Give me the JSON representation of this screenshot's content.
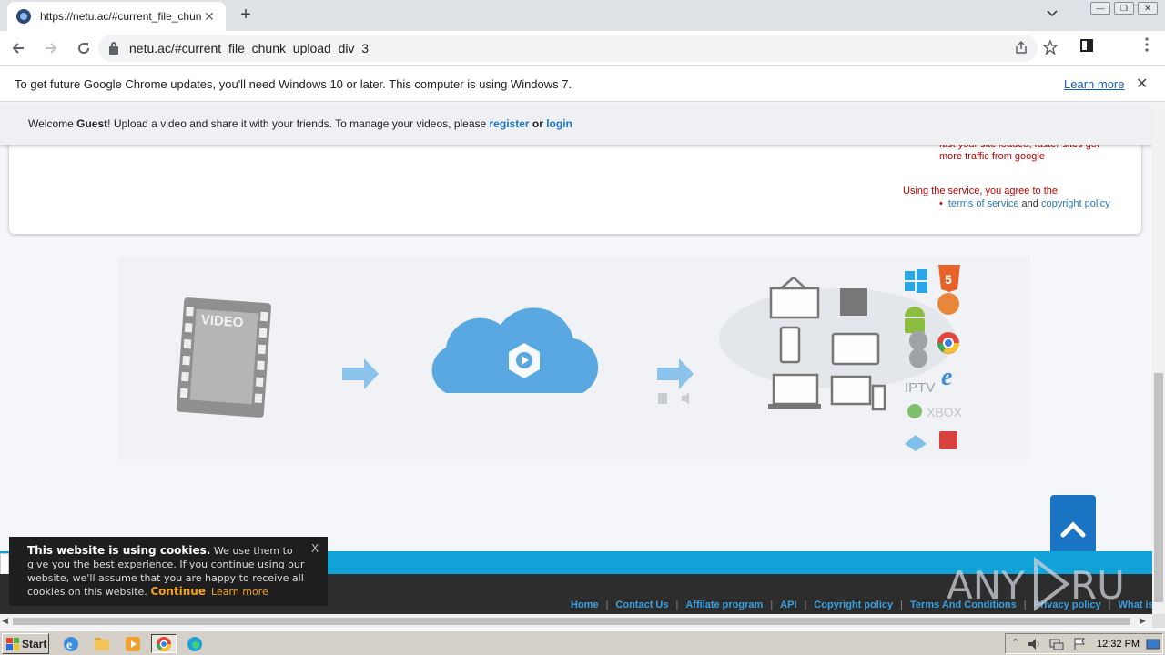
{
  "browser": {
    "tab_title": "https://netu.ac/#current_file_chunk",
    "tab_close": "✕",
    "new_tab": "+",
    "url": "netu.ac/#current_file_chunk_upload_div_3"
  },
  "infobar": {
    "message": "To get future Google Chrome updates, you'll need Windows 10 or later. This computer is using Windows 7.",
    "learn_more": "Learn more",
    "close": "✕"
  },
  "welcome": {
    "prefix": "Welcome ",
    "user": "Guest",
    "middle": "! Upload a video and share it with your friends. To manage your videos, please ",
    "register": "register",
    "or": " or ",
    "login": "login"
  },
  "panel": {
    "speed_line1": "fast your site loaded, faster sites got",
    "speed_line2": "more traffic from google",
    "agree": "Using the service, you agree to the",
    "terms": "terms of service",
    "and": " and ",
    "copyright": "copyright policy"
  },
  "illustration": {
    "film_label": "VIDEO",
    "iptv_label": "IPTV",
    "xbox_label": "XBOX",
    "html5_label": "5"
  },
  "cookie": {
    "title": "This website is using cookies.",
    "body": " We use them to give you the best experience. If you continue using our website, we'll assume that you are happy to receive all cookies on this website.",
    "continue": "Continue",
    "learn_more": "Learn more",
    "close": "X"
  },
  "footer": {
    "links": [
      "Home",
      "Contact Us",
      "Affilate program",
      "API",
      "Copyright policy",
      "Terms And Conditions",
      "Privacy policy",
      "What is i"
    ]
  },
  "taskbar": {
    "start": "Start",
    "clock": "12:32 PM"
  },
  "watermark": {
    "left": "ANY",
    "right": "RUN"
  },
  "colors": {
    "accent_blue": "#1c74c4",
    "footer_blue": "#12a3d9",
    "warning_red": "#c00000",
    "cookie_orange": "#f0a020"
  }
}
